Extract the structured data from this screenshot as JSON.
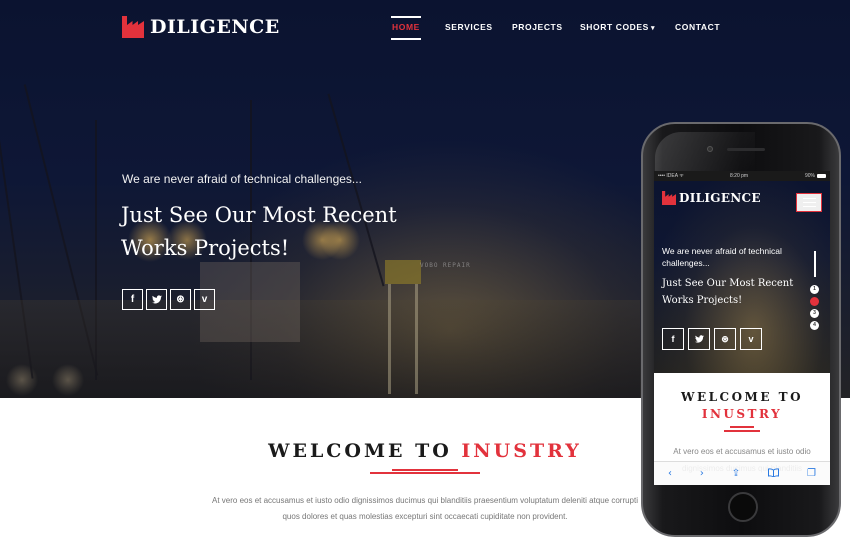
{
  "brand": {
    "name": "DILIGENCE",
    "logo_icon": "factory-icon",
    "accent_color": "#e2323c",
    "nav_bg": "#0b1330"
  },
  "nav": {
    "items": [
      {
        "label": "HOME",
        "active": true
      },
      {
        "label": "SERVICES",
        "active": false
      },
      {
        "label": "PROJECTS",
        "active": false
      },
      {
        "label": "SHORT CODES",
        "active": false,
        "dropdown": true,
        "caret": "▾"
      },
      {
        "label": "CONTACT",
        "active": false
      }
    ]
  },
  "hero": {
    "tagline": "We are never afraid of technical challenges...",
    "headline": "Just See Our Most Recent Works Projects!",
    "background_sign": "VOBO REPAIR",
    "social": [
      {
        "icon": "facebook-icon",
        "glyph": "f"
      },
      {
        "icon": "twitter-icon",
        "glyph": "t"
      },
      {
        "icon": "dribbble-icon",
        "glyph": "⊛"
      },
      {
        "icon": "vimeo-icon",
        "glyph": "v"
      }
    ]
  },
  "welcome": {
    "title_main": "WELCOME TO",
    "title_accent": "INUSTRY",
    "paragraph": "At vero eos et accusamus et iusto odio dignissimos ducimus qui blanditiis praesentium voluptatum deleniti atque corrupti quos dolores et quas molestias excepturi sint occaecati cupiditate non provident."
  },
  "phone": {
    "status": {
      "carrier": "•••• IDEA",
      "wifi": "wifi-icon",
      "time": "8:20 pm",
      "battery": "90%"
    },
    "brand": "DILIGENCE",
    "menu_icon": "hamburger-icon",
    "tagline": "We are never afraid of technical challenges...",
    "headline": "Just See Our Most Recent Works Projects!",
    "slides": [
      {
        "label": "1",
        "active": false
      },
      {
        "label": "2",
        "active": true
      },
      {
        "label": "3",
        "active": false
      },
      {
        "label": "4",
        "active": false
      }
    ],
    "social": [
      {
        "icon": "facebook-icon",
        "glyph": "f"
      },
      {
        "icon": "twitter-icon",
        "glyph": "t"
      },
      {
        "icon": "dribbble-icon",
        "glyph": "⊛"
      },
      {
        "icon": "vimeo-icon",
        "glyph": "v"
      }
    ],
    "welcome_main": "WELCOME TO",
    "welcome_accent": "INUSTRY",
    "paragraph": "At vero eos et accusamus et iusto odio dignissimos ducimus qui blanditiis",
    "safari": {
      "back": "‹",
      "forward": "›",
      "share": "⇪",
      "bookmarks": "📖",
      "tabs": "❐"
    }
  }
}
